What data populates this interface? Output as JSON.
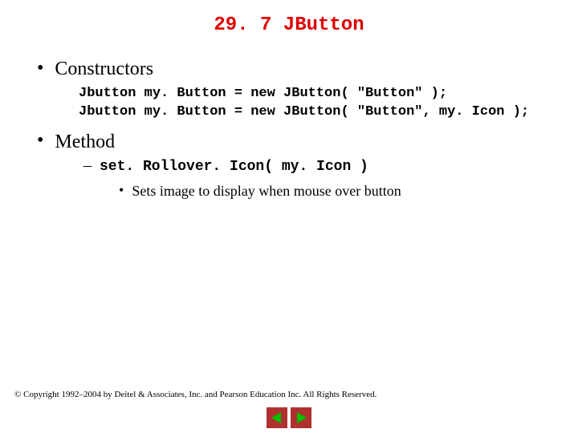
{
  "title": "29. 7  JButton",
  "sections": {
    "constructors": {
      "label": "Constructors",
      "code1": "Jbutton my. Button = new JButton( \"Button\" );",
      "code2": "Jbutton my. Button = new JButton( \"Button\", my. Icon );"
    },
    "method": {
      "label": "Method",
      "item1": "set. Rollover. Icon( my. Icon )",
      "desc1": "Sets image to display when mouse over button"
    }
  },
  "copyright": "© Copyright 1992–2004 by Deitel & Associates, Inc. and Pearson Education Inc. All Rights Reserved.",
  "icons": {
    "prev": "previous-slide",
    "next": "next-slide"
  }
}
